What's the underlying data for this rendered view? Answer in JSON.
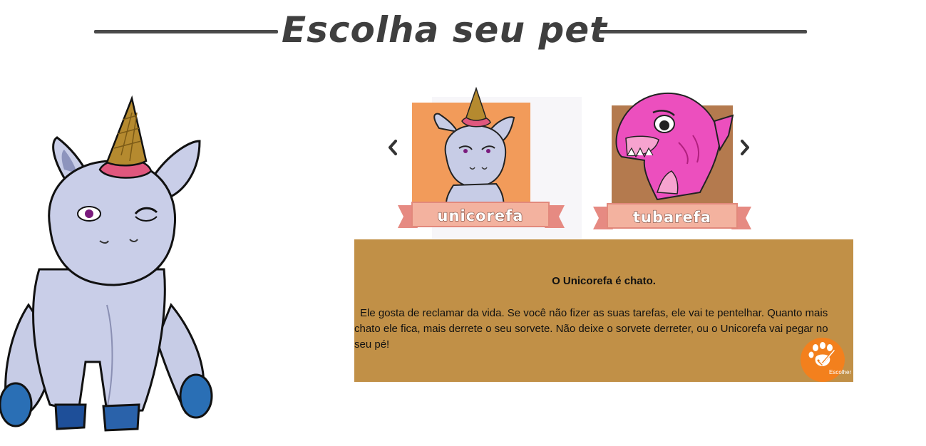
{
  "header": {
    "title": "Escolha seu pet"
  },
  "carousel": {
    "prev_icon": "chevron-left-icon",
    "next_icon": "chevron-right-icon",
    "items": [
      {
        "label": "unicorefa",
        "bg_color": "#f29b5a",
        "icon": "unicorn-elephant-icon"
      },
      {
        "label": "tubarefa",
        "bg_color": "#b47a4e",
        "icon": "pink-shark-icon"
      }
    ]
  },
  "info": {
    "title": "O Unicorefa é chato.",
    "text": "Ele gosta de reclamar da vida. Se você não fizer as suas tarefas, ele vai te pentelhar. Quanto mais chato ele fica, mais derrete o seu sorvete. Não deixe o sorvete derreter, ou o Unicorefa vai pegar no seu pé!",
    "bg_color": "#c19047",
    "choose_button": {
      "label": "Escolher",
      "icon": "paw-check-icon",
      "color": "#f3801d"
    }
  }
}
